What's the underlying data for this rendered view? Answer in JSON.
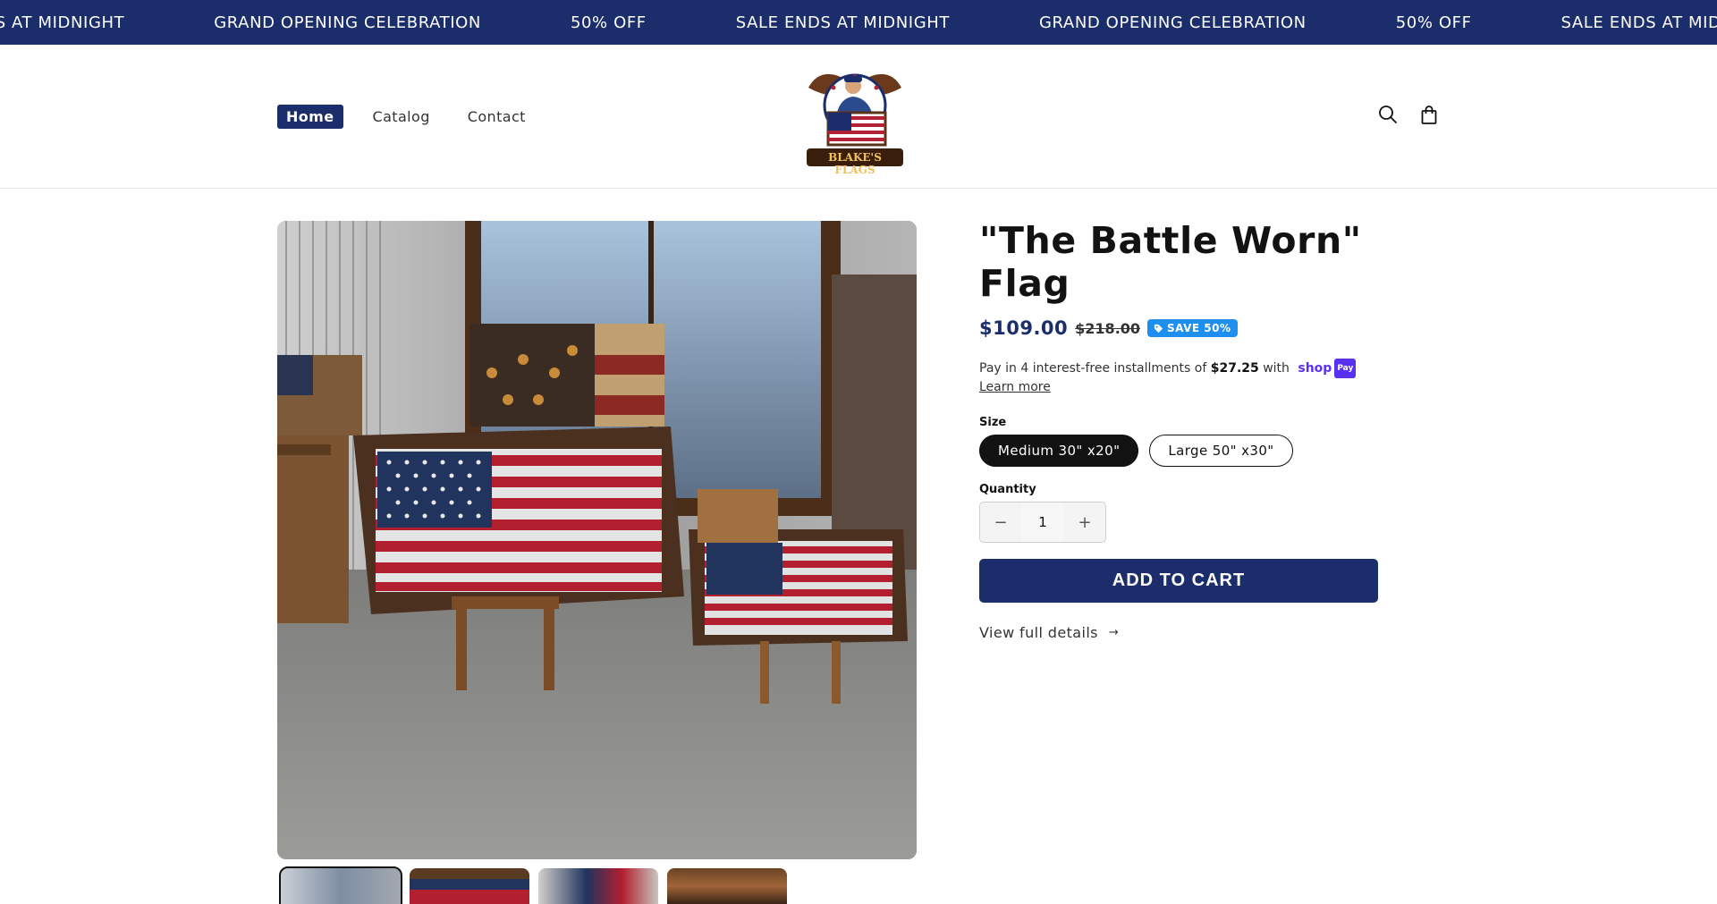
{
  "announcement": {
    "items": [
      "SALE ENDS AT MIDNIGHT",
      "GRAND OPENING CELEBRATION",
      "50% OFF",
      "SALE ENDS AT MIDNIGHT",
      "GRAND OPENING CELEBRATION",
      "50% OFF",
      "SALE ENDS AT MIDNIGHT"
    ]
  },
  "header": {
    "nav": [
      {
        "label": "Home",
        "active": true
      },
      {
        "label": "Catalog"
      },
      {
        "label": "Contact"
      }
    ],
    "logo_text": "BLAKE'S FLAGS",
    "icons": [
      "search-icon",
      "cart-icon"
    ]
  },
  "product": {
    "title": "\"The Battle Worn\" Flag",
    "price": "$109.00",
    "compare_price": "$218.00",
    "badge": "SAVE 50%",
    "installments_prefix": "Pay in 4 interest-free installments of ",
    "installments_amount": "$27.25",
    "installments_suffix": " with",
    "shoppay_word": "shop",
    "shoppay_pay": "Pay",
    "learn_more": "Learn more",
    "size_label": "Size",
    "sizes": [
      "Medium 30\" x20\"",
      "Large 50\" x30\""
    ],
    "selected_size": "Medium 30\" x20\"",
    "quantity_label": "Quantity",
    "quantity": "1",
    "qty_minus": "−",
    "qty_plus": "+",
    "add_to_cart": "ADD TO CART",
    "view_details": "View full details",
    "view_details_arrow": "→"
  },
  "colors": {
    "brand_navy": "#1b2e6b",
    "badge_blue": "#1f8fef",
    "shoppay_purple": "#5a31f4"
  }
}
